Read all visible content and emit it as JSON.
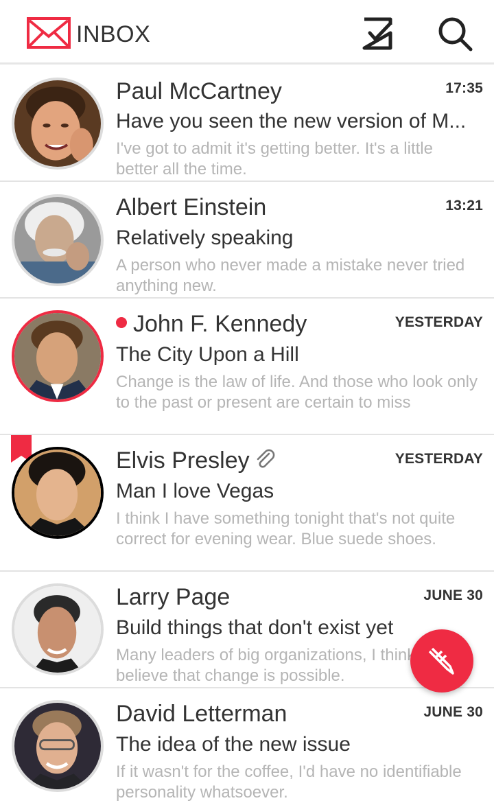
{
  "header": {
    "title": "INBOX",
    "logo_icon": "envelope-icon",
    "actions": [
      {
        "icon": "checkbox-icon"
      },
      {
        "icon": "search-icon"
      }
    ],
    "accent_color": "#ef2b43"
  },
  "messages": [
    {
      "sender": "Paul McCartney",
      "time": "17:35",
      "subject": "Have you seen the new version of M...",
      "preview": "I've got to admit it's getting better. It's a little better all the time.",
      "unread": false,
      "flagged": false,
      "attachment": false
    },
    {
      "sender": "Albert Einstein",
      "time": "13:21",
      "subject": "Relatively speaking",
      "preview": "A person who never made a mistake never tried anything new.",
      "unread": false,
      "flagged": false,
      "attachment": false
    },
    {
      "sender": "John F. Kennedy",
      "time": "YESTERDAY",
      "subject": "The City Upon a Hill",
      "preview": "Change is the law of life. And those who look only to the past or present are certain to miss",
      "unread": true,
      "flagged": false,
      "attachment": false
    },
    {
      "sender": "Elvis Presley",
      "time": "YESTERDAY",
      "subject": "Man I love Vegas",
      "preview": "I think I have something tonight that's not quite correct for evening wear. Blue suede shoes.",
      "unread": false,
      "flagged": true,
      "attachment": true
    },
    {
      "sender": "Larry Page",
      "time": "JUNE 30",
      "subject": "Build things that don't exist yet",
      "preview": "Many leaders of big organizations, I think don't believe that change is possible.",
      "unread": false,
      "flagged": false,
      "attachment": false
    },
    {
      "sender": "David Letterman",
      "time": "JUNE 30",
      "subject": "The idea of the new issue",
      "preview": "If it wasn't for the coffee, I'd have no identifiable personality whatsoever.",
      "unread": false,
      "flagged": false,
      "attachment": false
    }
  ],
  "compose": {
    "icon": "compose-pencil-icon"
  }
}
